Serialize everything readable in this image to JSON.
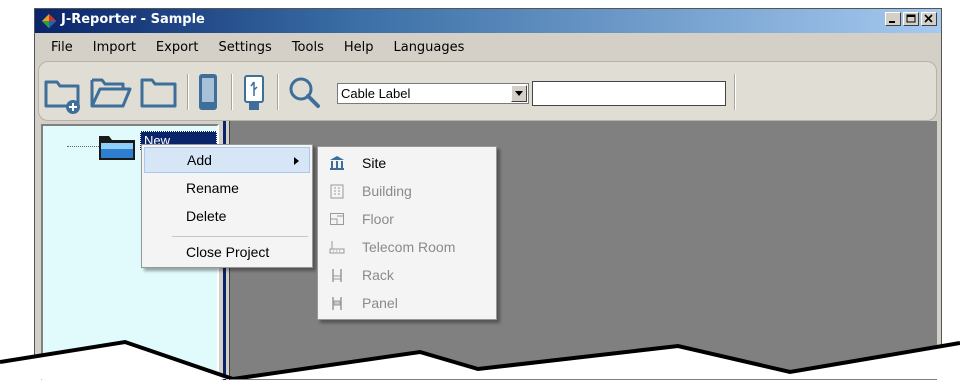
{
  "window": {
    "title": "J-Reporter - Sample"
  },
  "menu": [
    "File",
    "Import",
    "Export",
    "Settings",
    "Tools",
    "Help",
    "Languages"
  ],
  "toolbar": {
    "combo_value": "Cable Label",
    "search_value": ""
  },
  "tree": {
    "node_label": "New Project"
  },
  "context_menu": {
    "add": "Add",
    "rename": "Rename",
    "delete": "Delete",
    "close_project": "Close Project"
  },
  "submenu": {
    "site": "Site",
    "building": "Building",
    "floor": "Floor",
    "telecom_room": "Telecom Room",
    "rack": "Rack",
    "panel": "Panel"
  },
  "colors": {
    "title_bar": "#0a246a",
    "tree_background": "#e1fbfd",
    "workspace": "#808080",
    "menu_highlight": "#d6e6f7",
    "icon_accent": "#3d6f9a"
  },
  "icons": [
    "app-icon",
    "new-project-icon",
    "open-folder-icon",
    "folder-icon",
    "device-icon",
    "usb-device-icon",
    "search-icon",
    "site-icon",
    "building-icon",
    "floor-icon",
    "telecom-room-icon",
    "rack-icon",
    "panel-icon"
  ]
}
